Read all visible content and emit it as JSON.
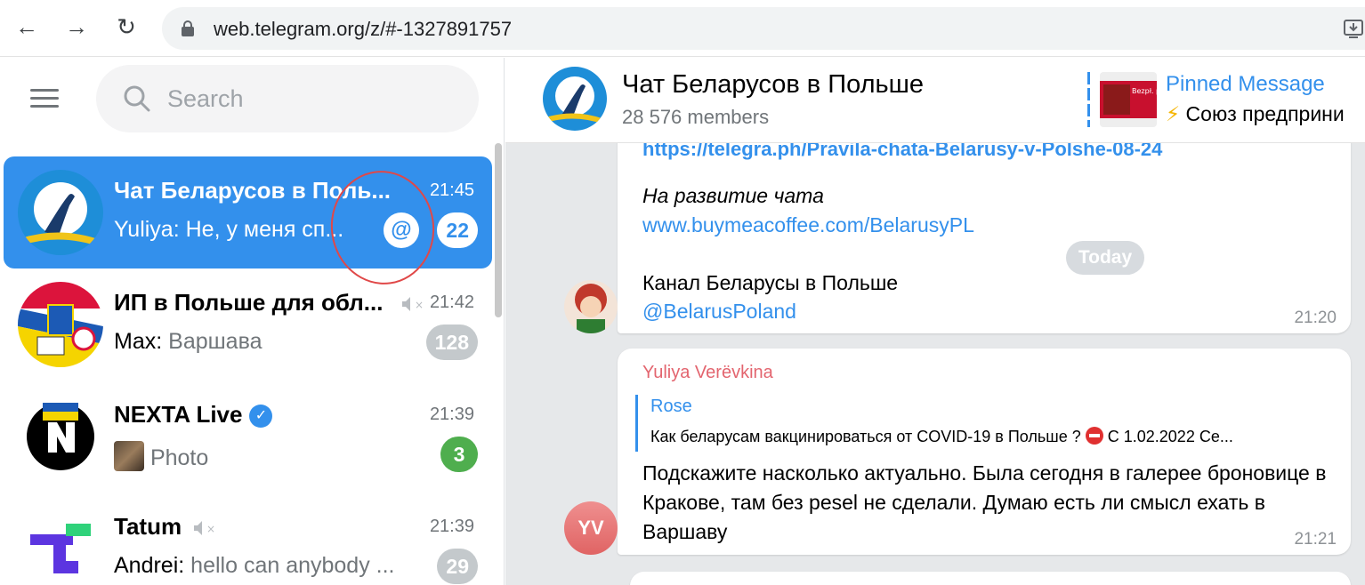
{
  "browser": {
    "url": "web.telegram.org/z/#-1327891757",
    "back_icon": "←",
    "forward_icon": "→",
    "reload_icon": "↻"
  },
  "search": {
    "placeholder": "Search"
  },
  "chats": [
    {
      "title": "Чат Беларусов в Поль...",
      "time": "21:45",
      "sender": "Yuliya:",
      "preview": "Не, у меня сп...",
      "mention": "@",
      "unread": "22",
      "active": true
    },
    {
      "title": "ИП в Польше для обл...",
      "time": "21:42",
      "sender": "Max:",
      "preview": "Варшава",
      "unread": "128",
      "muted": true
    },
    {
      "title": "NEXTA Live",
      "time": "21:39",
      "sender": "",
      "preview": "Photo",
      "unread": "3",
      "verified": "✓"
    },
    {
      "title": "Tatum",
      "time": "21:39",
      "sender": "Andrei:",
      "preview": "hello can anybody ...",
      "unread": "29",
      "muted": true
    }
  ],
  "mute_label": "×",
  "header": {
    "title": "Чат Беларусов в Польше",
    "members": "28 576 members",
    "pinned_title": "Pinned Message",
    "pinned_text": "Союз предприни",
    "pinned_bolt": "⚡",
    "pinned_thumb_text": "Bezpł. pomoc Białorusinów"
  },
  "messages": {
    "m1": {
      "link_top": "https://telegra.ph/Pravila-chata-Belarusy-v-Polshe-08-24",
      "italic": "На развитие чата",
      "link": "www.buymeacoffee.com/BelarusyPL",
      "channel": "Канал Беларусы в Польше",
      "channel_link": "@BelarusPoland",
      "time": "21:20"
    },
    "date_label": "Today",
    "m2": {
      "sender": "Yuliya Verëvkina",
      "reply_name": "Rose",
      "reply_text_1": "Как беларусам вакцинироваться от COVID-19 в Польше ?",
      "reply_text_2": "С 1.02.2022 Се...",
      "body": "Подскажите насколько актуально. Была сегодня в галерее броновице в Кракове, там без pesel не сделали. Думаю есть ли смысл ехать в Варшаву",
      "time": "21:21",
      "avatar_initials": "YV"
    }
  }
}
